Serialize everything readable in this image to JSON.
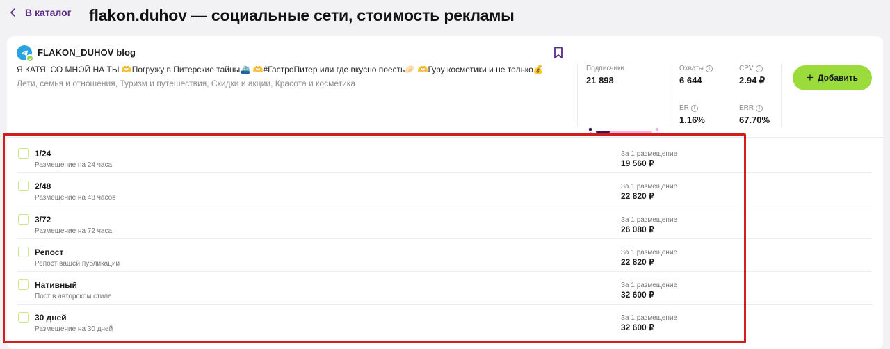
{
  "topbar": {
    "back_label": "В каталог",
    "title": "flakon.duhov — социальные сети, стоимость рекламы"
  },
  "channel": {
    "name": "FLAKON_DUHOV blog",
    "description": "Я КАТЯ, СО МНОЙ НА ТЫ 🫶Погружу в Питерские тайны⛴️ 🫶#ГастроПитер или где вкусно поесть🥟 🫶Гуру косметики и не только💰",
    "categories": "Дети, семья и отношения, Туризм и путешествия, Скидки и акции, Красота и косметика",
    "avatar_color": "#2aa3e0"
  },
  "stats": {
    "subscribers": {
      "label": "Подписчики",
      "value": "21 898",
      "bar_fraction": 0.25
    },
    "reach": {
      "label": "Охваты",
      "value": "6 644"
    },
    "cpv": {
      "label": "CPV",
      "value": "2.94 ₽"
    },
    "er": {
      "label": "ER",
      "value": "1.16%"
    },
    "err": {
      "label": "ERR",
      "value": "67.70%"
    }
  },
  "actions": {
    "add_label": "Добавить",
    "add_color": "#9bdb3c"
  },
  "formats": [
    {
      "title": "1/24",
      "subtitle": "Размещение на 24 часа",
      "price_label": "За 1 размещение",
      "price": "19 560 ₽"
    },
    {
      "title": "2/48",
      "subtitle": "Размещение на 48 часов",
      "price_label": "За 1 размещение",
      "price": "22 820 ₽"
    },
    {
      "title": "3/72",
      "subtitle": "Размещение на 72 часа",
      "price_label": "За 1 размещение",
      "price": "26 080 ₽"
    },
    {
      "title": "Репост",
      "subtitle": "Репост вашей публикации",
      "price_label": "За 1 размещение",
      "price": "22 820 ₽"
    },
    {
      "title": "Нативный",
      "subtitle": "Пост в авторском стиле",
      "price_label": "За 1 размещение",
      "price": "32 600 ₽"
    },
    {
      "title": "30 дней",
      "subtitle": "Размещение на 30 дней",
      "price_label": "За 1 размещение",
      "price": "32 600 ₽"
    }
  ],
  "colors": {
    "accent_purple": "#5b2a86",
    "highlight_red": "#d21d1d",
    "checkbox_border": "#c9e78a"
  }
}
